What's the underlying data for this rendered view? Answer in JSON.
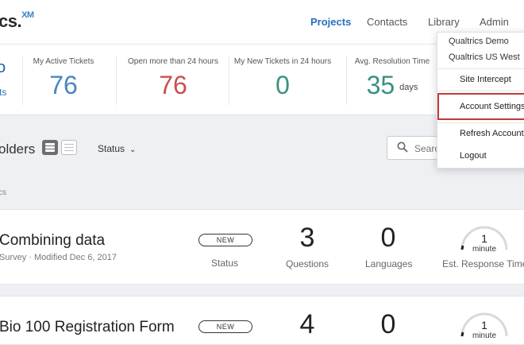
{
  "brand": {
    "logo_text": "cs.",
    "logo_suffix": "XM"
  },
  "nav": [
    {
      "label": "Projects",
      "active": true
    },
    {
      "label": "Contacts",
      "active": false
    },
    {
      "label": "Library",
      "active": false
    },
    {
      "label": "Admin",
      "active": false
    }
  ],
  "stats": {
    "left_fragment_top": "o",
    "left_fragment_link": "ts",
    "items": [
      {
        "label": "My Active Tickets",
        "value": "76",
        "color": "#4a86c0",
        "unit": ""
      },
      {
        "label": "Open more than 24 hours",
        "value": "76",
        "color": "#c94f4f",
        "unit": ""
      },
      {
        "label": "My New Tickets in 24 hours",
        "value": "0",
        "color": "#3b8f83",
        "unit": ""
      },
      {
        "label": "Avg. Resolution Time",
        "value": "35",
        "color": "#3b8f83",
        "unit": "days"
      }
    ]
  },
  "toolbar": {
    "folders_title": "olders",
    "status_filter": "Status",
    "search_placeholder": "Search",
    "column_fragment": "cs"
  },
  "projects": [
    {
      "title": "Combining data",
      "subtitle": "Survey · Modified Dec 6, 2017",
      "badge": "NEW",
      "status_label": "Status",
      "questions": "3",
      "questions_label": "Questions",
      "languages": "0",
      "languages_label": "Languages",
      "response_time": "1",
      "response_unit": "minute",
      "response_label": "Est. Response Time"
    },
    {
      "title": "Bio 100 Registration Form",
      "badge": "NEW",
      "questions": "4",
      "languages": "0",
      "response_time": "1",
      "response_unit": "minute"
    }
  ],
  "account_menu": {
    "brand_lines": [
      "Qualtrics Demo",
      "Qualtrics US West"
    ],
    "items": [
      {
        "label": "Site Intercept",
        "highlighted": false
      },
      {
        "label": "Account Settings",
        "highlighted": true
      },
      {
        "label": "Refresh Account",
        "highlighted": false
      },
      {
        "label": "Logout",
        "highlighted": false
      }
    ]
  },
  "colors": {
    "accent": "#2a6fbd",
    "highlight_border": "#c0393b"
  }
}
